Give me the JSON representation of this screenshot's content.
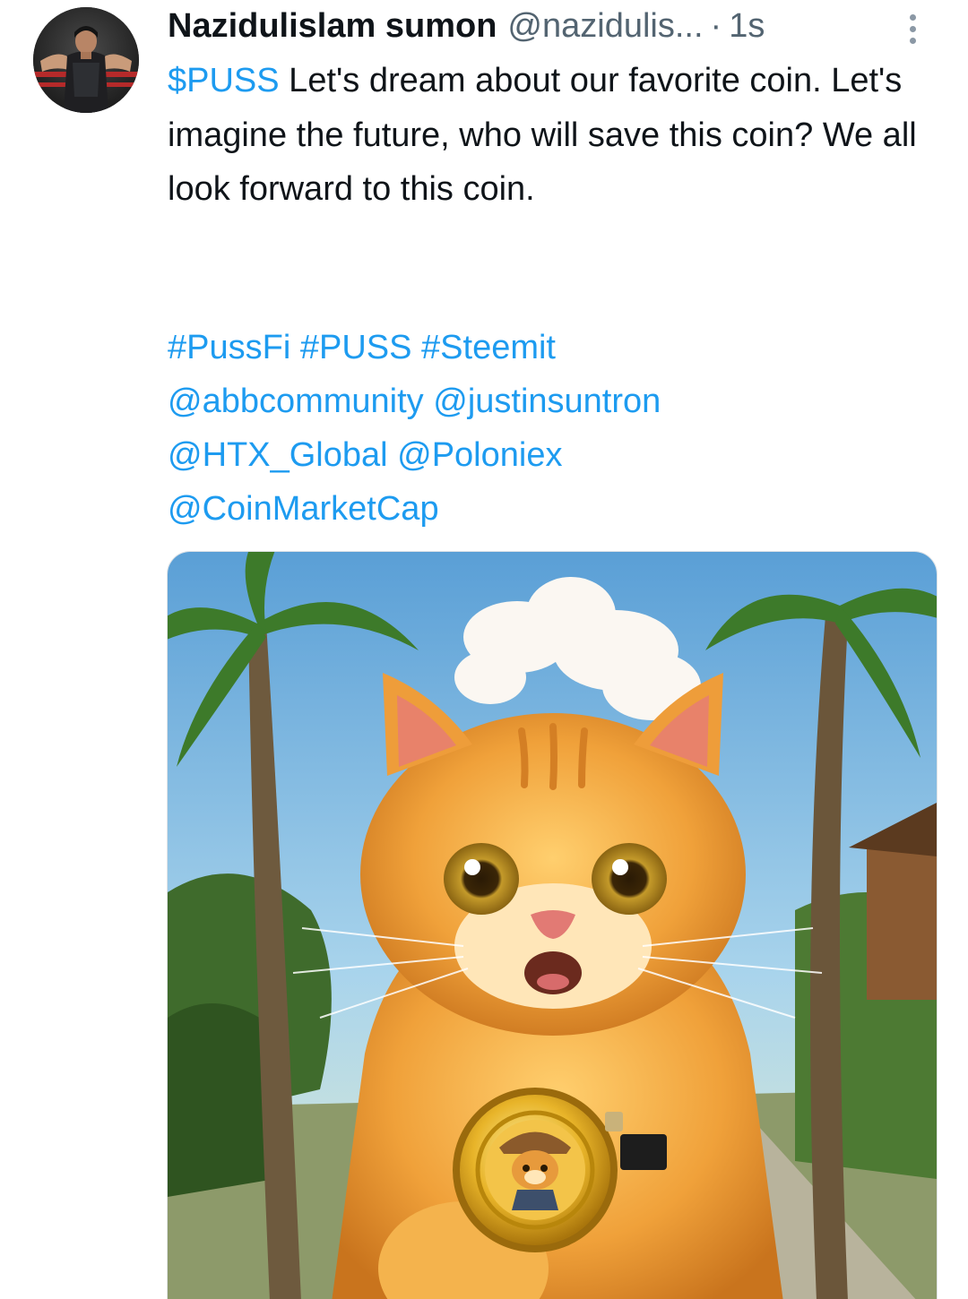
{
  "tweet": {
    "display_name": "Nazidulislam sumon",
    "handle": "@nazidulis...",
    "separator": "·",
    "time": "1s",
    "more_icon": "more-vertical-icon",
    "text": {
      "cashtag": "$PUSS",
      "body": " Let's dream about our favorite coin. Let's imagine the future, who will save this coin? We all look forward to this coin."
    },
    "hashtags": [
      "#PussFi",
      "#PUSS",
      "#Steemit"
    ],
    "mentions": [
      "@abbcommunity",
      "@justinsuntron",
      "@HTX_Global",
      "@Poloniex",
      "@CoinMarketCap"
    ]
  },
  "colors": {
    "link": "#1d9bf0",
    "text": "#0f1419",
    "secondary": "#536471"
  }
}
